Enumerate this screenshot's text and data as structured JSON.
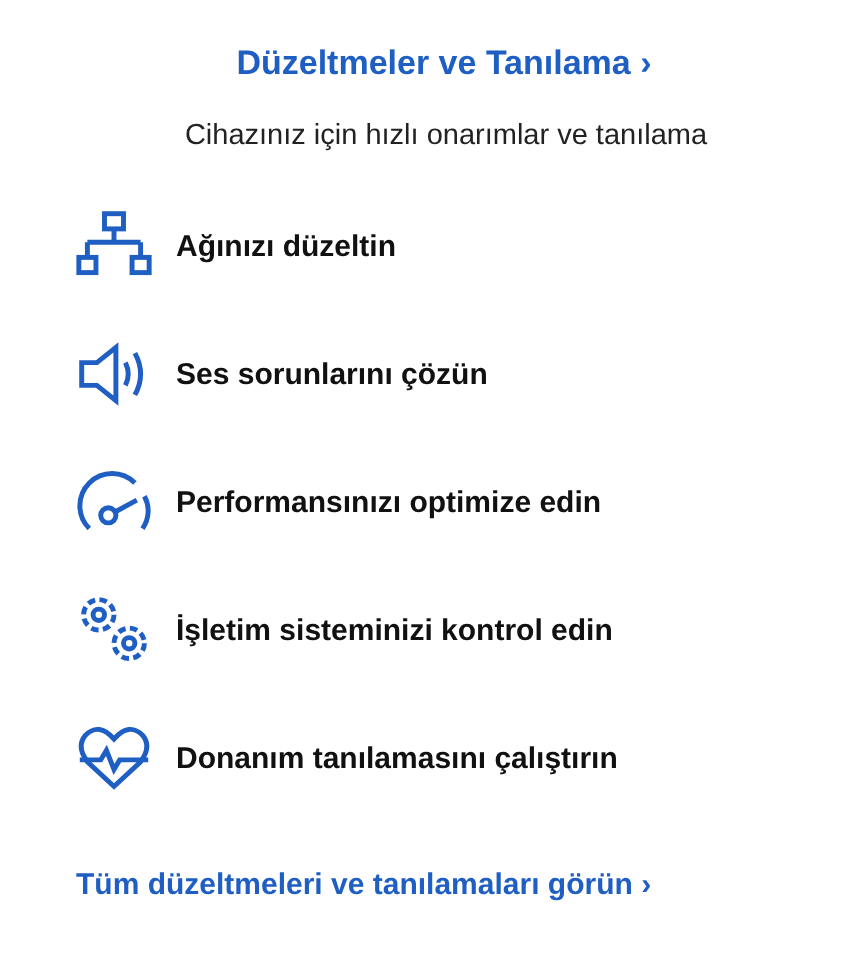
{
  "title": "Düzeltmeler ve Tanılama ›",
  "subtitle": "Cihazınız için hızlı onarımlar ve tanılama",
  "items": [
    {
      "kind": "network",
      "label": "Ağınızı düzeltin"
    },
    {
      "kind": "speaker",
      "label": "Ses sorunlarını çözün"
    },
    {
      "kind": "gauge",
      "label": "Performansınızı optimize edin"
    },
    {
      "kind": "gears",
      "label": "İşletim sisteminizi kontrol edin"
    },
    {
      "kind": "heart",
      "label": "Donanım tanılamasını çalıştırın"
    }
  ],
  "footer_link": "Tüm düzeltmeleri ve tanılamaları görün ›"
}
